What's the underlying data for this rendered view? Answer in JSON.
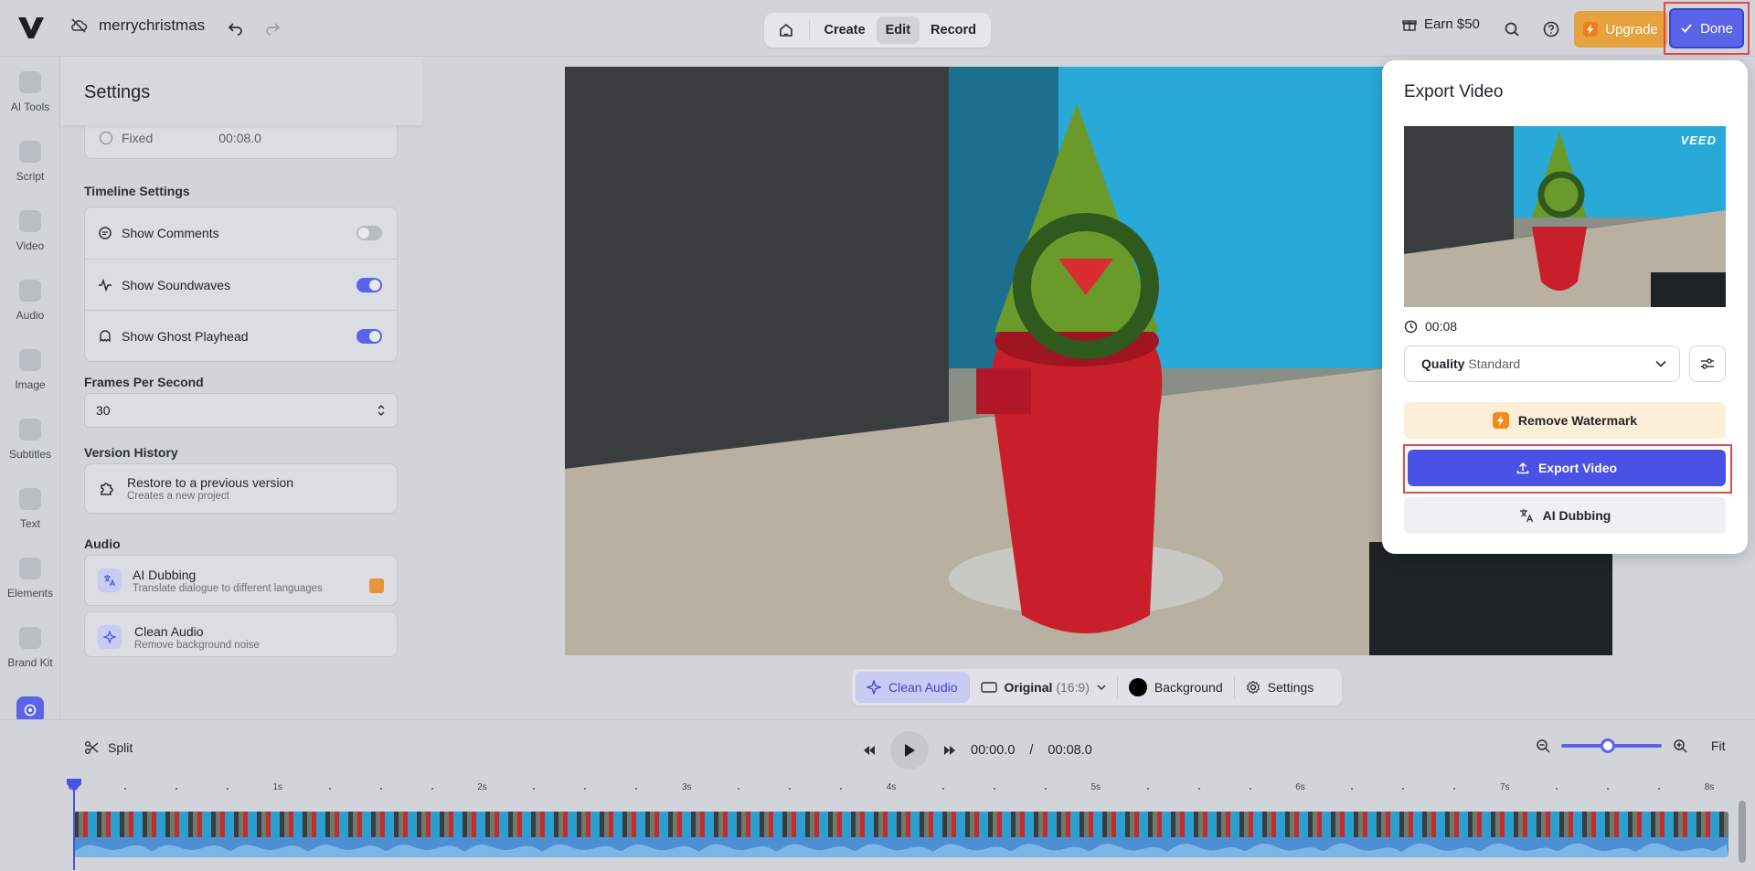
{
  "app": {
    "project_name": "merrychristmas",
    "modes": [
      {
        "label": "Create",
        "active": false
      },
      {
        "label": "Edit",
        "active": true
      },
      {
        "label": "Record",
        "active": false
      }
    ],
    "earn_label": "Earn $50",
    "upgrade_label": "Upgrade",
    "done_label": "Done",
    "accent": "#5b63e8"
  },
  "sidebar": {
    "items": [
      {
        "label": "AI Tools",
        "icon": "sparkle-plus-icon"
      },
      {
        "label": "Script",
        "icon": "script-icon"
      },
      {
        "label": "Video",
        "icon": "video-camera-icon"
      },
      {
        "label": "Audio",
        "icon": "music-note-icon"
      },
      {
        "label": "Image",
        "icon": "image-icon"
      },
      {
        "label": "Subtitles",
        "icon": "subtitles-icon"
      },
      {
        "label": "Text",
        "icon": "text-icon"
      },
      {
        "label": "Elements",
        "icon": "elements-icon"
      },
      {
        "label": "Brand Kit",
        "icon": "brand-kit-icon"
      },
      {
        "label": "Settings",
        "icon": "settings-icon",
        "active": true
      }
    ]
  },
  "settings": {
    "title": "Settings",
    "duration_option": {
      "label": "Fixed",
      "value": "00:08.0"
    },
    "timeline_section": "Timeline Settings",
    "timeline_toggles": [
      {
        "label": "Show Comments",
        "on": false
      },
      {
        "label": "Show Soundwaves",
        "on": true
      },
      {
        "label": "Show Ghost Playhead",
        "on": true
      }
    ],
    "fps_section": "Frames Per Second",
    "fps_value": "30",
    "version_section": "Version History",
    "version": {
      "title": "Restore to a previous version",
      "subtitle": "Creates a new project"
    },
    "audio_section": "Audio",
    "audio_items": [
      {
        "title": "AI Dubbing",
        "subtitle": "Translate dialogue to different languages"
      },
      {
        "title": "Clean Audio",
        "subtitle": "Remove background noise"
      }
    ]
  },
  "canvas_toolbar": {
    "clean_audio": "Clean Audio",
    "aspect": "Original",
    "aspect_ratio": "(16:9)",
    "background": "Background",
    "settings": "Settings"
  },
  "export": {
    "title": "Export Video",
    "watermark": "VEED",
    "duration": "00:08",
    "quality_label": "Quality",
    "quality_value": "Standard",
    "remove_watermark": "Remove Watermark",
    "export_button": "Export Video",
    "ai_dubbing": "AI Dubbing"
  },
  "timeline": {
    "split_label": "Split",
    "current_time": "00:00.0",
    "separator": "/",
    "total_time": "00:08.0",
    "fit_label": "Fit",
    "zoom_fraction": 0.46,
    "ruler_labels": [
      "0s",
      "1s",
      "2s",
      "3s",
      "4s",
      "5s",
      "6s",
      "7s",
      "8s"
    ]
  }
}
